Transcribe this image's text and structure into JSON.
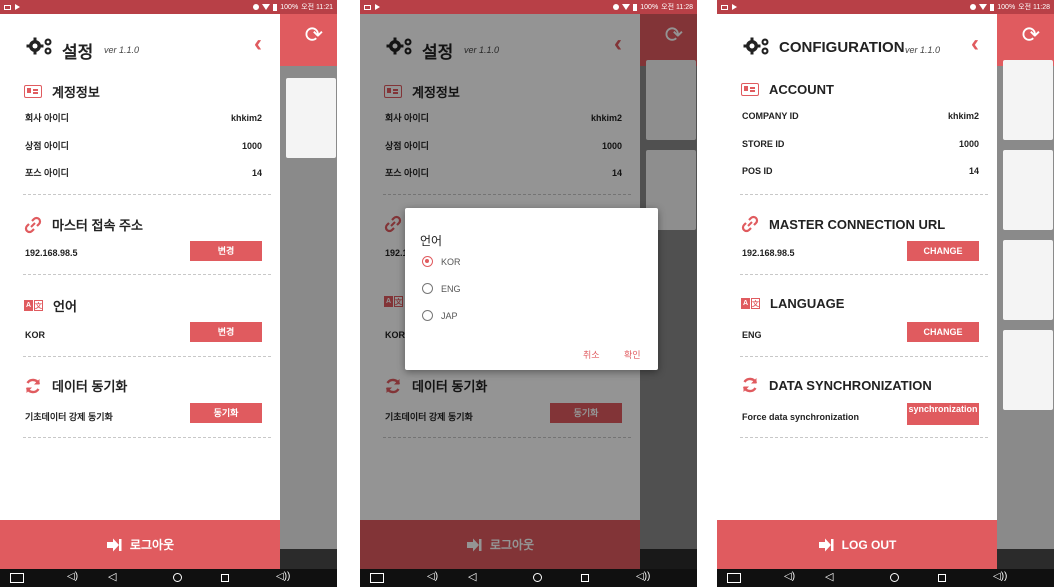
{
  "colors": {
    "accent": "#e05b5f",
    "status_bar": "#b84047"
  },
  "screens": [
    {
      "status": {
        "battery": "100%",
        "time": "오전 11:21"
      },
      "header": {
        "title": "설정",
        "version": "ver 1.1.0"
      },
      "account": {
        "title": "계정정보",
        "rows": [
          {
            "label": "회사 아이디",
            "value": "khkim2"
          },
          {
            "label": "상점 아이디",
            "value": "1000"
          },
          {
            "label": "포스 아이디",
            "value": "14"
          }
        ]
      },
      "master": {
        "title": "마스터 접속 주소",
        "url": "192.168.98.5",
        "button": "변경"
      },
      "language": {
        "title": "언어",
        "value": "KOR",
        "button": "변경"
      },
      "sync": {
        "title": "데이터 동기화",
        "label": "기초데이터 강제 동기화",
        "button": "동기화"
      },
      "logout": "로그아웃"
    },
    {
      "status": {
        "battery": "100%",
        "time": "오전 11:28"
      },
      "header": {
        "title": "설정",
        "version": "ver 1.1.0"
      },
      "account": {
        "title": "계정정보",
        "rows": [
          {
            "label": "회사 아이디",
            "value": "khkim2"
          },
          {
            "label": "상점 아이디",
            "value": "1000"
          },
          {
            "label": "포스 아이디",
            "value": "14"
          }
        ]
      },
      "master": {
        "url_partial": "192.1"
      },
      "language": {
        "value_partial": "KOR"
      },
      "sync": {
        "title": "데이터 동기화",
        "label": "기초데이터 강제 동기화",
        "button": "동기화"
      },
      "logout": "로그아웃",
      "dialog": {
        "title": "언어",
        "options": [
          "KOR",
          "ENG",
          "JAP"
        ],
        "selected": "KOR",
        "cancel": "취소",
        "confirm": "확인"
      }
    },
    {
      "status": {
        "battery": "100%",
        "time": "오전 11:28"
      },
      "header": {
        "title": "CONFIGURATION",
        "version": "ver 1.1.0"
      },
      "account": {
        "title": "ACCOUNT",
        "rows": [
          {
            "label": "COMPANY ID",
            "value": "khkim2"
          },
          {
            "label": "STORE ID",
            "value": "1000"
          },
          {
            "label": "POS ID",
            "value": "14"
          }
        ]
      },
      "master": {
        "title": "MASTER CONNECTION URL",
        "url": "192.168.98.5",
        "button": "CHANGE"
      },
      "language": {
        "title": "LANGUAGE",
        "value": "ENG",
        "button": "CHANGE"
      },
      "sync": {
        "title": "DATA SYNCHRONIZATION",
        "label": "Force data synchronization",
        "button": "synchronization"
      },
      "logout": "LOG OUT"
    }
  ]
}
